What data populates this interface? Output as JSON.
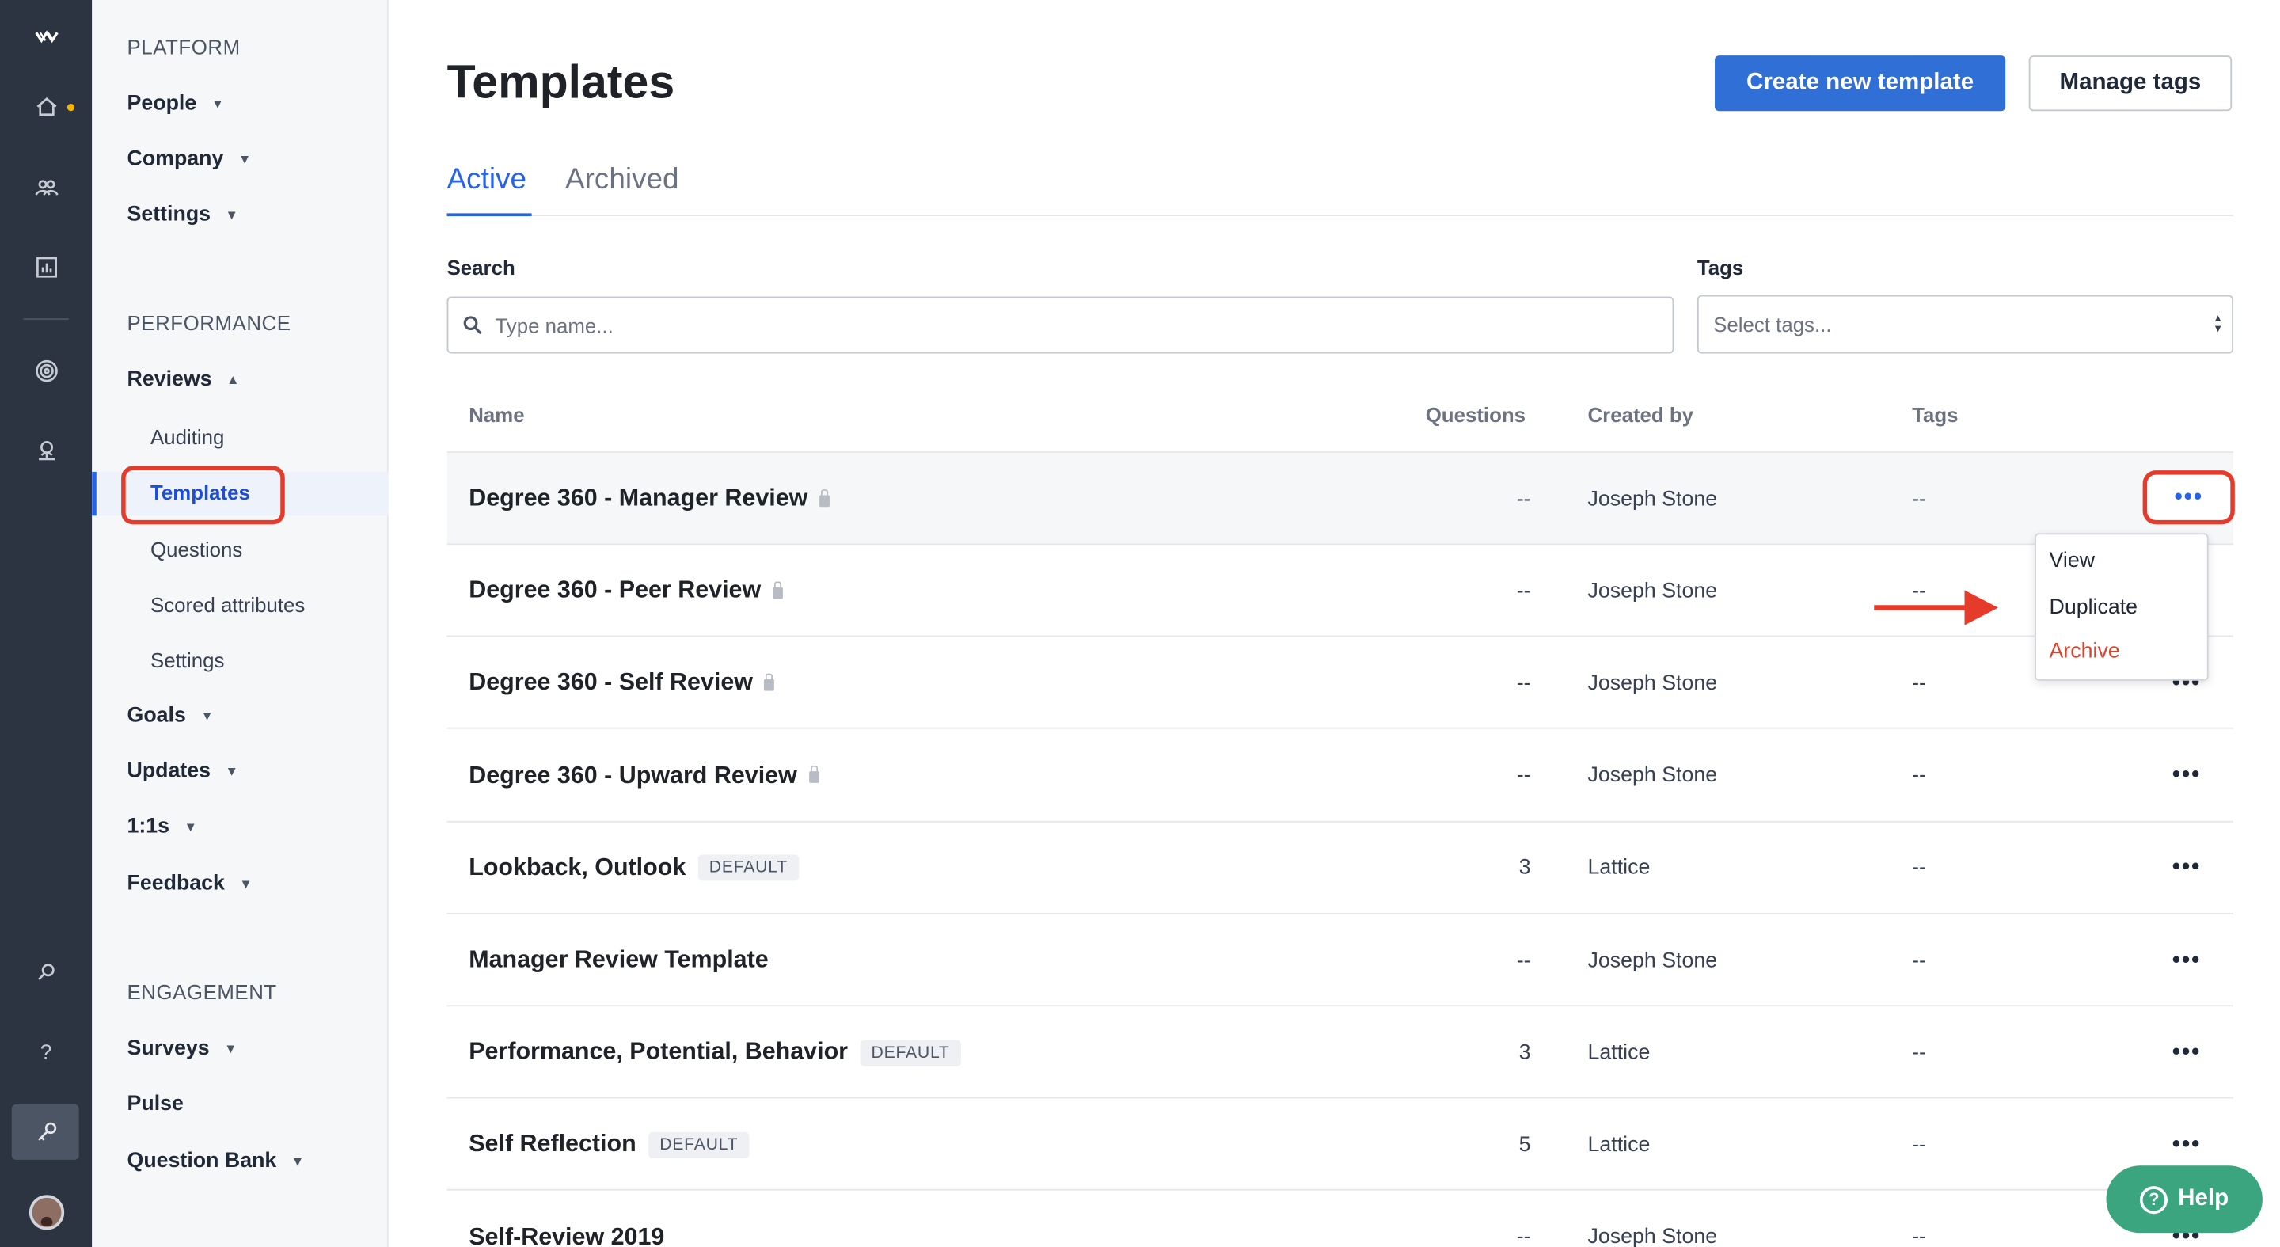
{
  "rail": {
    "icons": [
      "lattice-logo-icon",
      "home-icon",
      "people-icon",
      "analytics-icon",
      "goals-target-icon",
      "growth-icon",
      "search-icon",
      "help-question-icon",
      "admin-key-icon",
      "user-avatar"
    ],
    "notification_color": "#f5b400"
  },
  "sidenav": {
    "platform": {
      "title": "PLATFORM",
      "items": [
        {
          "label": "People"
        },
        {
          "label": "Company"
        },
        {
          "label": "Settings"
        }
      ]
    },
    "performance": {
      "title": "PERFORMANCE",
      "reviews": {
        "label": "Reviews",
        "subitems": [
          {
            "label": "Auditing"
          },
          {
            "label": "Templates"
          },
          {
            "label": "Questions"
          },
          {
            "label": "Scored attributes"
          },
          {
            "label": "Settings"
          }
        ]
      },
      "items": [
        {
          "label": "Goals"
        },
        {
          "label": "Updates"
        },
        {
          "label": "1:1s"
        },
        {
          "label": "Feedback"
        }
      ]
    },
    "engagement": {
      "title": "ENGAGEMENT",
      "items": [
        {
          "label": "Surveys"
        },
        {
          "label": "Pulse"
        },
        {
          "label": "Question Bank"
        }
      ]
    }
  },
  "header": {
    "title": "Templates",
    "create_button": "Create new template",
    "manage_tags_button": "Manage tags"
  },
  "tabs": [
    {
      "label": "Active",
      "selected": true
    },
    {
      "label": "Archived",
      "selected": false
    }
  ],
  "filters": {
    "search_label": "Search",
    "search_placeholder": "Type name...",
    "tags_label": "Tags",
    "tags_placeholder": "Select tags..."
  },
  "table": {
    "columns": [
      "Name",
      "Questions",
      "Created by",
      "Tags"
    ],
    "rows": [
      {
        "name": "Degree 360 - Manager Review",
        "locked": true,
        "badge": "",
        "questions": "--",
        "created_by": "Joseph Stone",
        "tags": "--"
      },
      {
        "name": "Degree 360 - Peer Review",
        "locked": true,
        "badge": "",
        "questions": "--",
        "created_by": "Joseph Stone",
        "tags": "--"
      },
      {
        "name": "Degree 360 - Self Review",
        "locked": true,
        "badge": "",
        "questions": "--",
        "created_by": "Joseph Stone",
        "tags": "--"
      },
      {
        "name": "Degree 360 - Upward Review",
        "locked": true,
        "badge": "",
        "questions": "--",
        "created_by": "Joseph Stone",
        "tags": "--"
      },
      {
        "name": "Lookback, Outlook",
        "locked": false,
        "badge": "DEFAULT",
        "questions": "3",
        "created_by": "Lattice",
        "tags": "--"
      },
      {
        "name": "Manager Review Template",
        "locked": false,
        "badge": "",
        "questions": "--",
        "created_by": "Joseph Stone",
        "tags": "--"
      },
      {
        "name": "Performance, Potential, Behavior",
        "locked": false,
        "badge": "DEFAULT",
        "questions": "3",
        "created_by": "Lattice",
        "tags": "--"
      },
      {
        "name": "Self Reflection",
        "locked": false,
        "badge": "DEFAULT",
        "questions": "5",
        "created_by": "Lattice",
        "tags": "--"
      },
      {
        "name": "Self-Review 2019",
        "locked": false,
        "badge": "",
        "questions": "--",
        "created_by": "Joseph Stone",
        "tags": "--"
      }
    ],
    "more_label": "•••"
  },
  "context_menu": {
    "items": [
      {
        "label": "View"
      },
      {
        "label": "Duplicate"
      },
      {
        "label": "Archive",
        "danger": true
      }
    ]
  },
  "help": {
    "label": "Help",
    "glyph": "?"
  },
  "colors": {
    "accent": "#2f6fd6",
    "highlight": "#e53b2a",
    "danger": "#d9432f",
    "help_green": "#3aa57f",
    "rail_bg": "#2b3440"
  }
}
